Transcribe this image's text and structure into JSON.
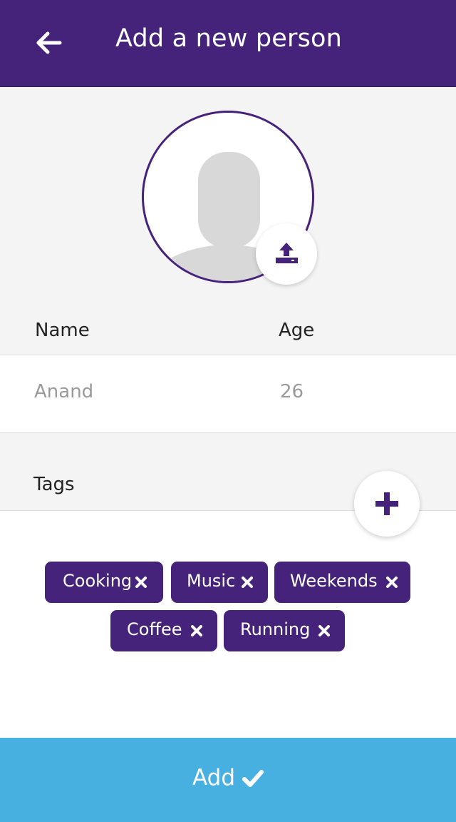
{
  "header": {
    "title": "Add a new person",
    "back_icon": "arrow-left-icon",
    "background": "#46237a"
  },
  "avatar": {
    "placeholder_icon": "person-silhouette-icon",
    "upload_icon": "upload-icon",
    "border_color": "#46237a"
  },
  "form": {
    "name_label": "Name",
    "age_label": "Age",
    "name_value": "Anand",
    "age_value": "26"
  },
  "tags": {
    "label": "Tags",
    "add_icon": "plus-icon",
    "items": [
      {
        "label": "Cooking"
      },
      {
        "label": "Music"
      },
      {
        "label": "Weekends"
      },
      {
        "label": "Coffee"
      },
      {
        "label": "Running"
      }
    ],
    "chip_color": "#46237a",
    "remove_icon": "close-x-icon"
  },
  "footer": {
    "add_label": "Add",
    "check_icon": "checkmark-icon",
    "background": "#48b0e1"
  }
}
